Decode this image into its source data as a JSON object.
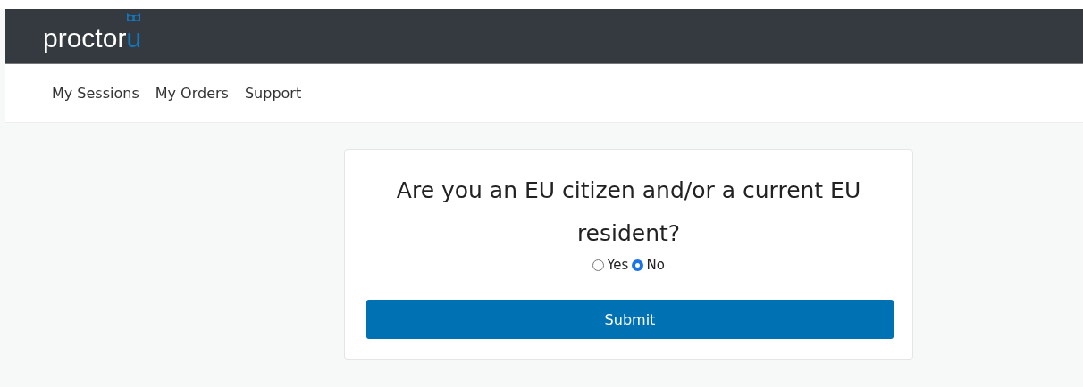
{
  "header": {
    "logo": {
      "text": "proctor",
      "accent": "u"
    }
  },
  "nav": {
    "items": [
      {
        "label": "My Sessions"
      },
      {
        "label": "My Orders"
      },
      {
        "label": "Support"
      }
    ]
  },
  "form": {
    "question": "Are you an EU citizen and/or a current EU resident?",
    "options": [
      {
        "label": "Yes",
        "selected": false
      },
      {
        "label": "No",
        "selected": true
      }
    ],
    "submit": "Submit"
  }
}
